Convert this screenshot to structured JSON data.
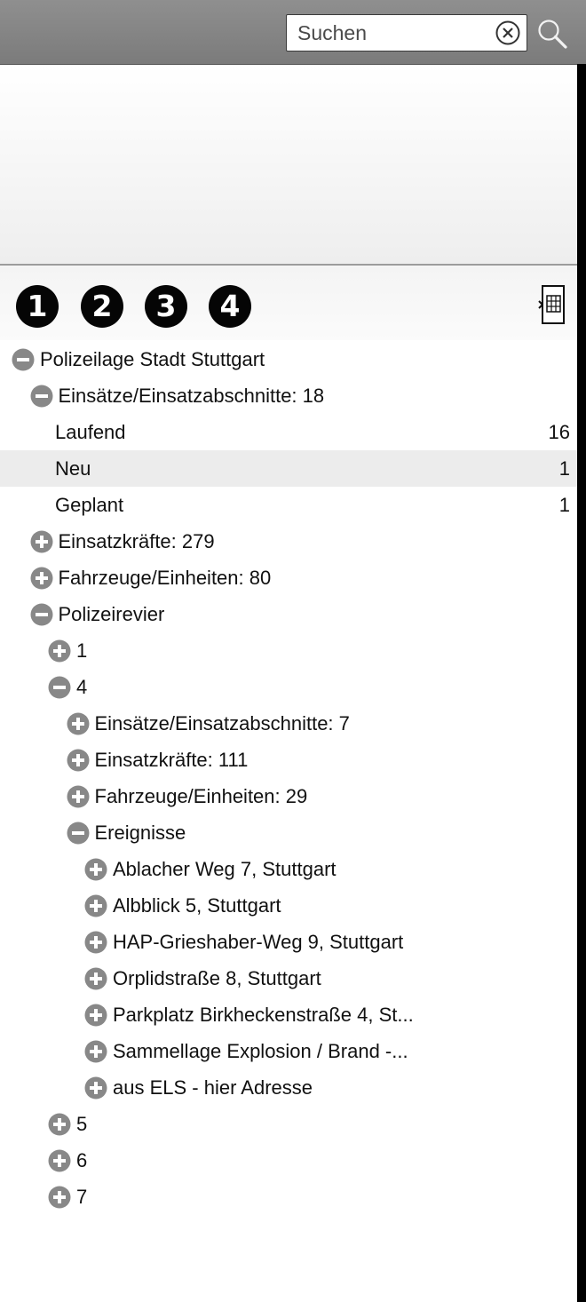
{
  "search": {
    "placeholder": "Suchen",
    "clear_icon": "clear-circle-icon",
    "search_icon": "magnifier-icon"
  },
  "toolbar": {
    "buttons": [
      "1",
      "2",
      "3",
      "4"
    ],
    "calc_icon": "calculator-icon"
  },
  "tree": [
    {
      "label": "Polizeilage Stadt Stuttgart",
      "level": 0,
      "toggle": "minus",
      "count": ""
    },
    {
      "label": "Einsätze/Einsatzabschnitte: 18",
      "level": 1,
      "toggle": "minus",
      "count": ""
    },
    {
      "label": "Laufend",
      "level": 2,
      "toggle": "none",
      "count": "16"
    },
    {
      "label": "Neu",
      "level": 2,
      "toggle": "none",
      "count": "1",
      "selected": true
    },
    {
      "label": "Geplant",
      "level": 2,
      "toggle": "none",
      "count": "1"
    },
    {
      "label": "Einsatzkräfte: 279",
      "level": 1,
      "toggle": "plus",
      "count": ""
    },
    {
      "label": "Fahrzeuge/Einheiten: 80",
      "level": 1,
      "toggle": "plus",
      "count": ""
    },
    {
      "label": "Polizeirevier",
      "level": 1,
      "toggle": "minus",
      "count": ""
    },
    {
      "label": "1",
      "level": 2,
      "toggle": "plus",
      "count": ""
    },
    {
      "label": "4",
      "level": 2,
      "toggle": "minus",
      "count": ""
    },
    {
      "label": "Einsätze/Einsatzabschnitte: 7",
      "level": 3,
      "toggle": "plus",
      "count": ""
    },
    {
      "label": "Einsatzkräfte: 111",
      "level": 3,
      "toggle": "plus",
      "count": ""
    },
    {
      "label": "Fahrzeuge/Einheiten: 29",
      "level": 3,
      "toggle": "plus",
      "count": ""
    },
    {
      "label": "Ereignisse",
      "level": 3,
      "toggle": "minus",
      "count": ""
    },
    {
      "label": "Ablacher Weg 7, Stuttgart",
      "level": 4,
      "toggle": "plus",
      "count": ""
    },
    {
      "label": "Albblick 5, Stuttgart",
      "level": 4,
      "toggle": "plus",
      "count": ""
    },
    {
      "label": "HAP-Grieshaber-Weg 9, Stuttgart",
      "level": 4,
      "toggle": "plus",
      "count": ""
    },
    {
      "label": "Orplidstraße 8, Stuttgart",
      "level": 4,
      "toggle": "plus",
      "count": ""
    },
    {
      "label": "Parkplatz Birkheckenstraße 4, St...",
      "level": 4,
      "toggle": "plus",
      "count": ""
    },
    {
      "label": "Sammellage Explosion / Brand -...",
      "level": 4,
      "toggle": "plus",
      "count": ""
    },
    {
      "label": "aus ELS - hier Adresse",
      "level": 4,
      "toggle": "plus",
      "count": ""
    },
    {
      "label": "5",
      "level": 2,
      "toggle": "plus",
      "count": ""
    },
    {
      "label": "6",
      "level": 2,
      "toggle": "plus",
      "count": ""
    },
    {
      "label": "7",
      "level": 2,
      "toggle": "plus",
      "count": ""
    }
  ],
  "colors": {
    "toggle_fill": "#888888",
    "selected_row": "#ececec",
    "topbar": "#858585"
  }
}
